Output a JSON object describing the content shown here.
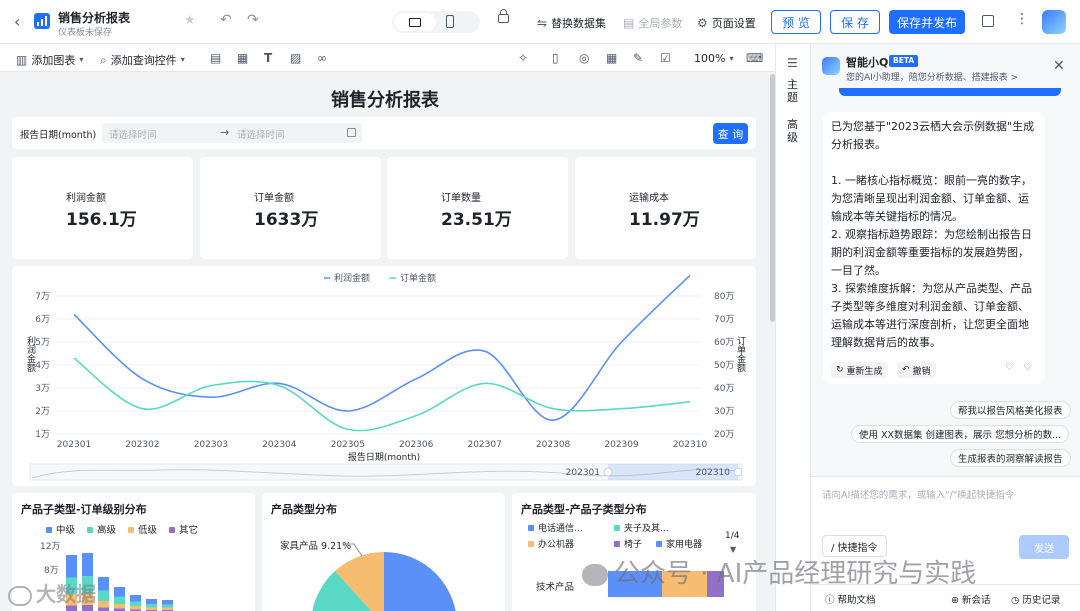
{
  "header": {
    "title": "销售分析报表",
    "subtitle": "仪表板未保存",
    "actions": {
      "replace_dataset": "替换数据集",
      "global_params": "全局参数",
      "page_settings": "页面设置",
      "preview": "预 览",
      "save": "保 存",
      "save_publish": "保存并发布"
    }
  },
  "toolbar": {
    "add_chart": "添加图表",
    "add_query_control": "添加查询控件",
    "zoom": "100%"
  },
  "rail": {
    "theme": "主题",
    "advanced": "高级"
  },
  "report": {
    "title": "销售分析报表",
    "filter_label": "报告日期(month)",
    "start_placeholder": "请选择时间",
    "end_placeholder": "请选择时间",
    "query_button": "查 询"
  },
  "kpis": [
    {
      "label": "利润金额",
      "value": "156.1万"
    },
    {
      "label": "订单金额",
      "value": "1633万"
    },
    {
      "label": "订单数量",
      "value": "23.51万"
    },
    {
      "label": "运输成本",
      "value": "11.97万"
    }
  ],
  "colors": {
    "primary": "#1f6fff",
    "profit": "#5b8ff9",
    "order": "#5ad8c6",
    "orange": "#f6bd70",
    "purple": "#9270ca"
  },
  "chart_data": [
    {
      "type": "line",
      "x": [
        "202301",
        "202302",
        "202303",
        "202304",
        "202305",
        "202306",
        "202307",
        "202308",
        "202309",
        "202310"
      ],
      "series": [
        {
          "name": "利润金额",
          "axis": "left",
          "values": [
            6.2,
            3.4,
            2.6,
            3.2,
            2.0,
            3.4,
            4.6,
            1.6,
            5.0,
            7.9
          ]
        },
        {
          "name": "订单金额",
          "axis": "right",
          "values": [
            53,
            31,
            41,
            41,
            22,
            28,
            42,
            31,
            31,
            34
          ]
        }
      ],
      "xlabel": "报告日期(month)",
      "ylabel": "利润金额",
      "y2label": "订单金额",
      "yticks": [
        "7万",
        "6万",
        "5万",
        "4万",
        "3万",
        "2万",
        "1万"
      ],
      "y2ticks": [
        "80万",
        "70万",
        "60万",
        "50万",
        "40万",
        "30万",
        "20万"
      ],
      "ylim": [
        1,
        7
      ],
      "y2lim": [
        20,
        80
      ],
      "legend": "top",
      "range_start": "202301",
      "range_end": "202310"
    },
    {
      "type": "bar",
      "title": "产品子类型-订单级别分布",
      "legend": [
        "中级",
        "高级",
        "低级",
        "其它"
      ],
      "yticks": [
        "12万",
        "8万"
      ]
    },
    {
      "type": "pie",
      "title": "产品类型分布",
      "slices": [
        {
          "name": "家具产品",
          "label": "家具产品 9.21%",
          "value": 9.21
        }
      ]
    },
    {
      "type": "bar",
      "title": "产品类型-产品子类型分布",
      "legend": [
        "电话通信...",
        "夹子及其...",
        "办公机器",
        "椅子",
        "家用电器"
      ],
      "categories": [
        "技术产品"
      ],
      "page": "1/4"
    }
  ],
  "assistant": {
    "name": "智能小Q",
    "badge": "BETA",
    "tagline": "您的AI小助理，陪您分析数据、搭建报表 >",
    "message_intro": "已为您基于\"2023云栖大会示例数据\"生成分析报表。",
    "points": [
      "1. 一睹核心指标概览：眼前一亮的数字，为您清晰呈现出利润金额、订单金额、运输成本等关键指标的情况。",
      "2. 观察指标趋势跟踪：为您绘制出报告日期的利润金额等重要指标的发展趋势图，一目了然。",
      "3. 探索维度拆解：为您从产品类型、产品子类型等多维度对利润金额、订单金额、运输成本等进行深度剖析，让您更全面地理解数据背后的故事。"
    ],
    "regenerate": "重新生成",
    "undo": "撤销",
    "suggestions": [
      "帮我以报告风格美化报表",
      "使用 XX数据集 创建图表，展示 您想分析的数...",
      "生成报表的洞察解读报告"
    ],
    "input_placeholder": "请向AI描述您的需求，或输入\"/\"唤起快捷指令",
    "shortcut": "/ 快捷指令",
    "send": "发送",
    "help": "帮助文档",
    "new_session": "新会话",
    "history": "历史记录"
  },
  "watermarks": {
    "left": "大数据",
    "right": "公众号 · AI产品经理研究与实践"
  }
}
